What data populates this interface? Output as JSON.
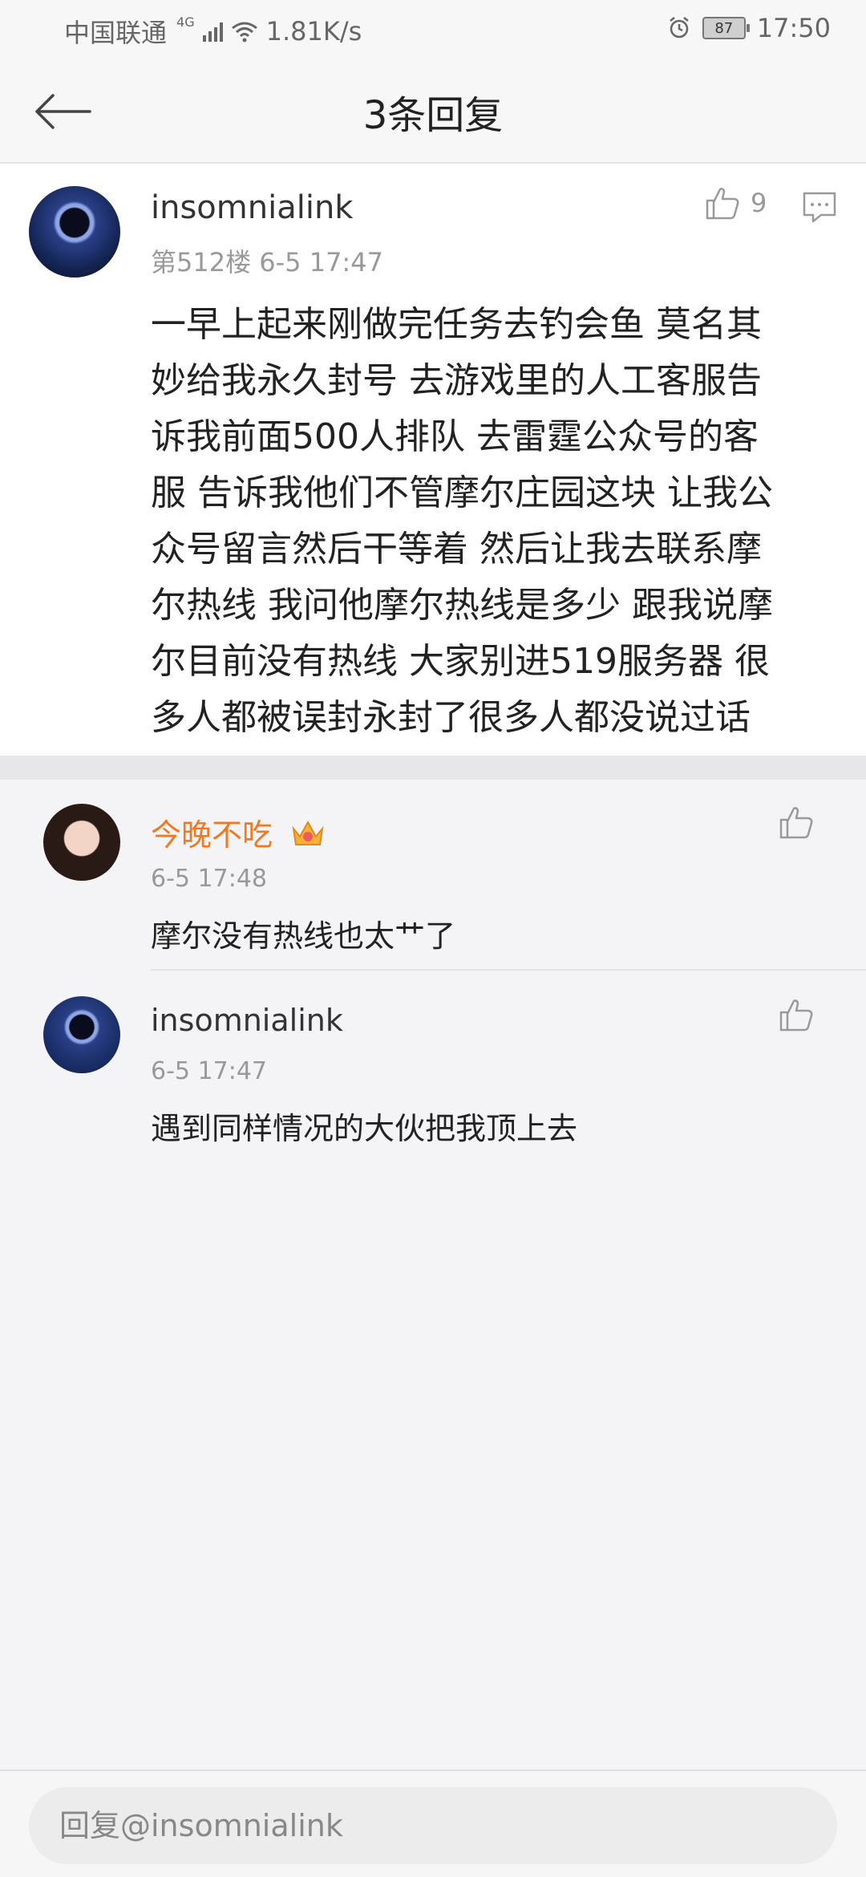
{
  "status_bar": {
    "carrier": "中国联通",
    "network": "4G",
    "speed": "1.81K/s",
    "battery": "87",
    "time": "17:50"
  },
  "header": {
    "title": "3条回复",
    "back_icon": "back-arrow-icon"
  },
  "main_post": {
    "username": "insomnialink",
    "floor": "第512楼",
    "time": "6-5 17:47",
    "likes": "9",
    "text_lines": [
      "一早上起来刚做完任务去钓会鱼 莫名其",
      "妙给我永久封号 去游戏里的人工客服告",
      "诉我前面500人排队 去雷霆公众号的客",
      "服 告诉我他们不管摩尔庄园这块 让我公",
      "众号留言然后干等着 然后让我去联系摩",
      "尔热线 我问他摩尔热线是多少 跟我说摩",
      "尔目前没有热线 大家别进519服务器 很",
      "多人都被误封永封了很多人都没说过话"
    ]
  },
  "replies": [
    {
      "username": "今晚不吃",
      "time": "6-5 17:48",
      "text": "摩尔没有热线也太艹了",
      "badge_icon": "crown-icon"
    },
    {
      "username": "insomnialink",
      "time": "6-5 17:47",
      "text": "遇到同样情况的大伙把我顶上去"
    }
  ],
  "reply_input": {
    "placeholder": "回复@insomnialink"
  },
  "colors": {
    "accent_name": "#ef7a24",
    "muted": "#999999",
    "background": "#f4f4f6"
  }
}
